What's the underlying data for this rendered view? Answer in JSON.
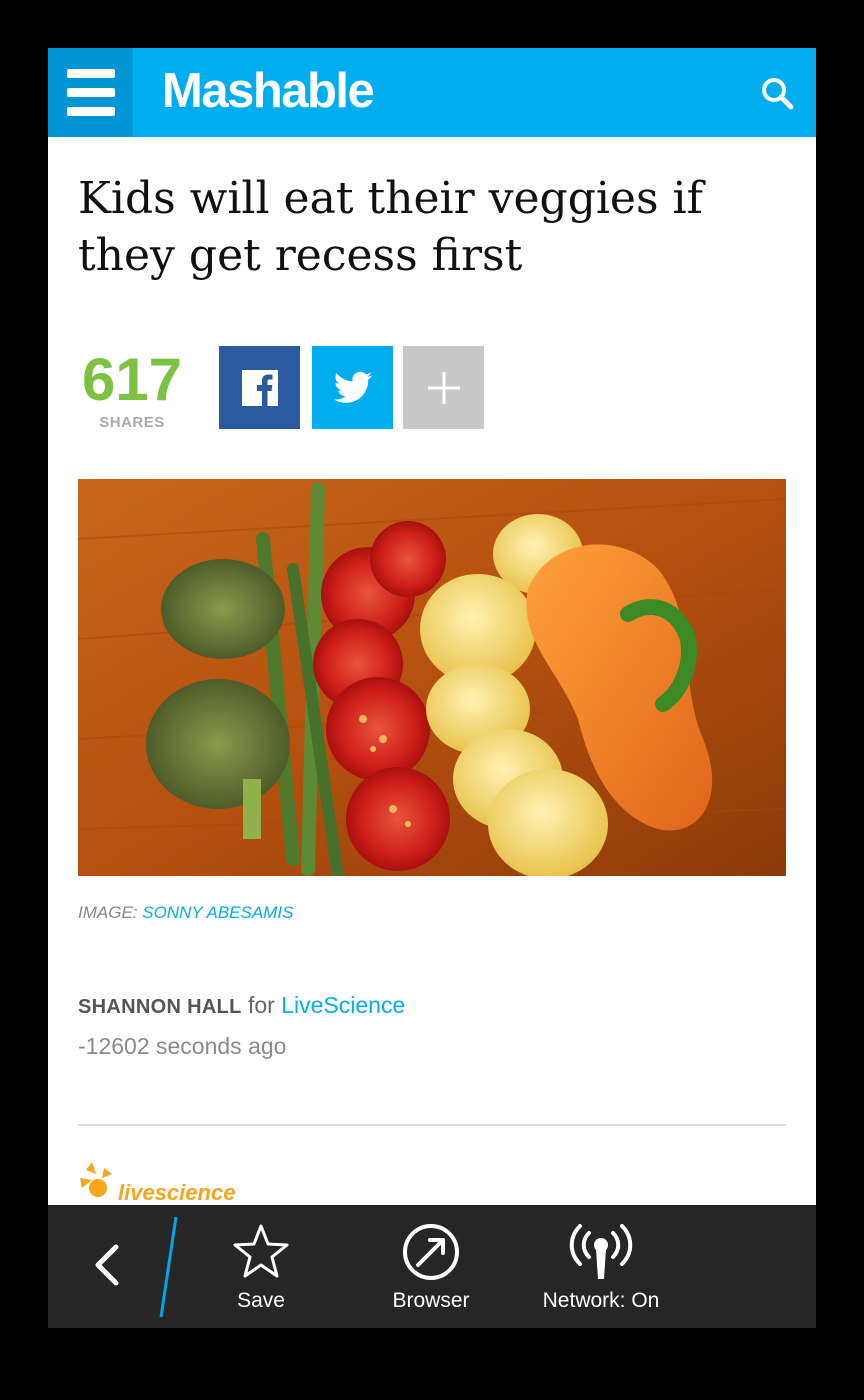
{
  "header": {
    "brand": "Mashable",
    "menu_icon": "hamburger-menu-icon",
    "search_icon": "search-icon",
    "brand_color": "#00aeef",
    "menu_bg_color": "#0096d3"
  },
  "article": {
    "title": "Kids will eat their veggies if they get recess first",
    "shares": {
      "count": "617",
      "label": "SHARES",
      "count_color": "#7cc142"
    },
    "share_buttons": [
      {
        "name": "facebook",
        "icon": "facebook-icon",
        "color": "#2b5a9e"
      },
      {
        "name": "twitter",
        "icon": "twitter-icon",
        "color": "#00aeef"
      },
      {
        "name": "more",
        "icon": "plus-icon",
        "color": "#c8c8c8"
      }
    ],
    "image_caption": {
      "prefix": "IMAGE:",
      "credit": "SONNY ABESAMIS"
    },
    "byline": {
      "author": "SHANNON HALL",
      "joiner": "for",
      "source": "LiveScience"
    },
    "timestamp": "-12602 seconds ago",
    "partner_logo": "livescience"
  },
  "bottom_bar": {
    "back_icon": "back-chevron-icon",
    "actions": [
      {
        "label": "Save",
        "icon": "star-icon"
      },
      {
        "label": "Browser",
        "icon": "browser-compass-icon"
      },
      {
        "label": "Network: On",
        "icon": "network-antenna-icon"
      }
    ],
    "accent_color": "#00a6e6"
  }
}
